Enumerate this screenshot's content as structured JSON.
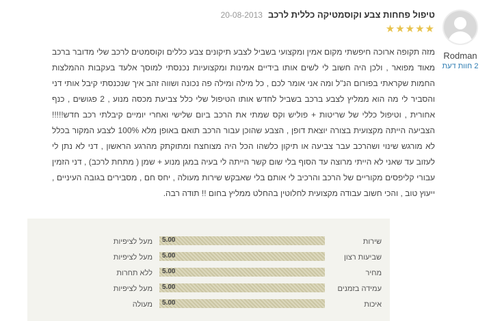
{
  "review": {
    "title": "טיפול פחחות צבע וקוסמטיקה כללית לרכב",
    "date": "20-08-2013",
    "stars": "★★★★★",
    "star_rating": 5,
    "text": "מזה תקופה ארוכה חיפשתי מקום אמין ומקצועי בשביל לצבע תיקונים צבע כללים וקוסמטים לרכב שלי מדובר ברכב מאוד מפואר , ולכן היה חשוב לי לשים אותו בידיים אמינות ומקצועיות נכנסתי למוסך אלעד בעקבות ההמלצות החמות שקראתי בפורום הנ\"ל ומה אני אומר לכם , כל מילה ומילה פה נכונה ושווה זהב איך שנכנסתי קיבל אותי דני והסביר לי מה הוא ממליץ לצבע ברכב בשביל לחדש אותו הטיפול שלי כלל צביעת מכסה מנוע , 2 פגושים , כנף אחורית , וטיפול כללי של שריטות + פוליש וקס שמתי את הרכב ביום שלישי ואחרי יומיים קיבלתי רכב חדש!!!!! הצביעה הייתה מקצועית בצורה יוצאת דופן , הצבע שהוכן עבור הרכב תואם באופן מלא 100% לצבע המקור בכלל לא מורגש שינוי ושהרכב עבר צביעה או תיקון כלשהו הכל היה מצוחצח ומתוקתק מהרגע הראשון , דני לא נתן לי לעזוב עד שאני לא הייתי מרוצה עד הסוף בלי שום קשר הייתה לי בעיה במגן מנוע + שמן ( מתחת לרכב) , דני הזמין עבורי קליפסים מקוריים של הרכב והרכיב לי אותם בלי שאבקש שירות מעולה , יחס חם , מסבירים בגובה העיניים , ייעוץ טוב , והכי חשוב עבודה מקצועית לחלוטין בהחלט ממליץ בחום !! תודה רבה."
  },
  "reviewer": {
    "name": "Rodman",
    "count": "2 חוות דעת"
  },
  "ratings": [
    {
      "label": "שירות",
      "score": "5.00",
      "value": 5,
      "desc": "מעל לציפיות"
    },
    {
      "label": "שביעות רצון",
      "score": "5.00",
      "value": 5,
      "desc": "מעל לציפיות"
    },
    {
      "label": "מחיר",
      "score": "5.00",
      "value": 5,
      "desc": "ללא תחרות"
    },
    {
      "label": "עמידה בזמנים",
      "score": "5.00",
      "value": 5,
      "desc": "מעל לציפיות"
    },
    {
      "label": "איכות",
      "score": "5.00",
      "value": 5,
      "desc": "מעולה"
    }
  ],
  "colors": {
    "star": "#e8c24a",
    "link": "#2a7ab0",
    "ratings_bg": "#f3f3ee"
  }
}
